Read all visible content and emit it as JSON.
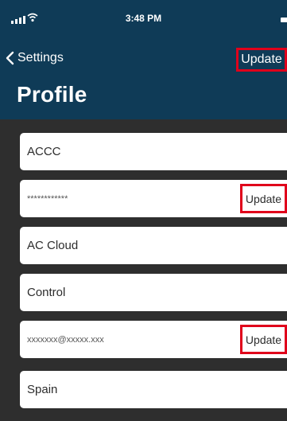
{
  "status_bar": {
    "time": "3:48 PM"
  },
  "nav": {
    "back_label": "Settings",
    "update_label": "Update",
    "title": "Profile"
  },
  "fields": [
    {
      "value": "ACCC"
    },
    {
      "value": "************",
      "action": "Update"
    },
    {
      "value": "AC Cloud"
    },
    {
      "value": "Control"
    },
    {
      "value": "xxxxxxx@xxxxx.xxx",
      "action": "Update"
    },
    {
      "value": "Spain"
    }
  ],
  "colors": {
    "header": "#0f3b57",
    "content_bg": "#2e2e2e",
    "highlight": "#e0001b"
  },
  "icons": [
    "signal-icon",
    "wifi-icon",
    "battery-icon",
    "chevron-left-icon"
  ]
}
